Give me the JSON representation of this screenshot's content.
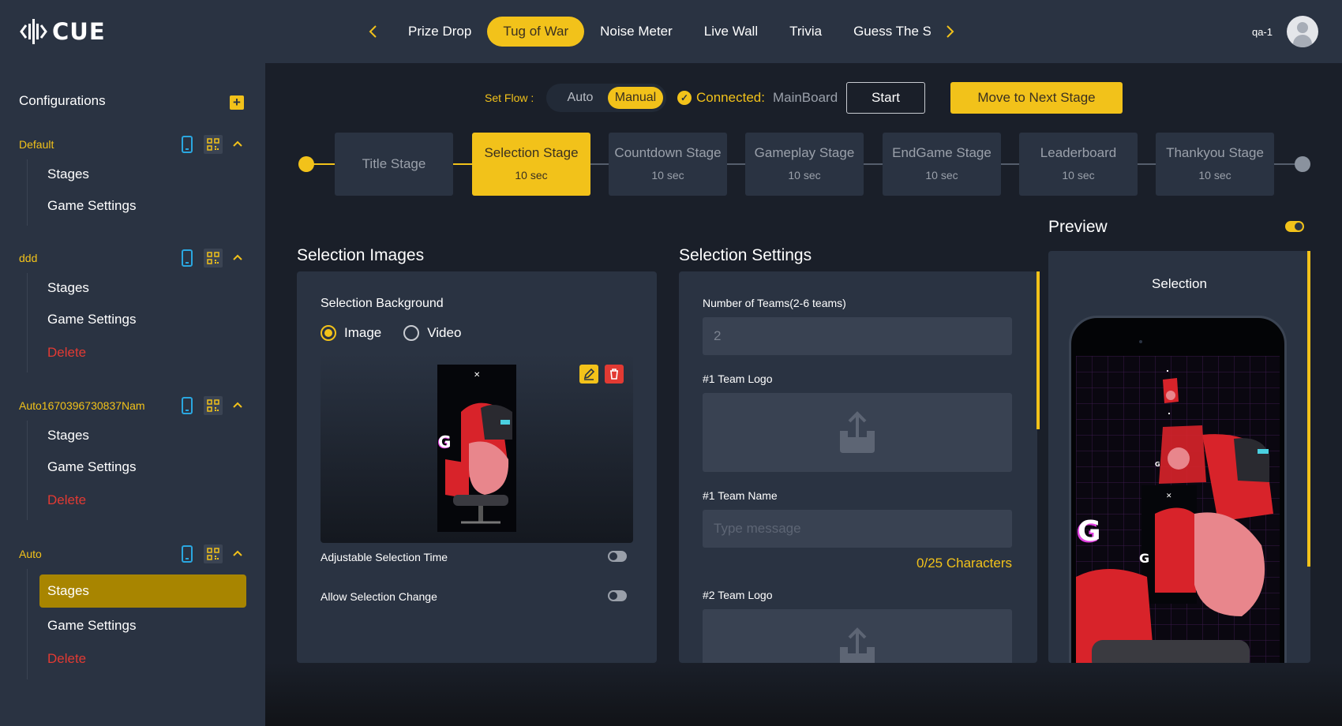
{
  "brand": {
    "name": "CUE"
  },
  "colors": {
    "accent": "#f2c21a",
    "danger": "#e23a33",
    "panel": "#2a3342",
    "background": "#1a1f29"
  },
  "nav": {
    "tabs": [
      {
        "label": "Prize Drop",
        "active": false
      },
      {
        "label": "Tug of War",
        "active": true
      },
      {
        "label": "Noise Meter",
        "active": false
      },
      {
        "label": "Live Wall",
        "active": false
      },
      {
        "label": "Trivia",
        "active": false
      },
      {
        "label": "Guess The Sc",
        "active": false
      }
    ],
    "prev_icon": "chevron-left-icon",
    "next_icon": "chevron-right-icon"
  },
  "user": {
    "name": "qa-1",
    "avatar_icon": "user-avatar-icon"
  },
  "sidebar": {
    "title": "Configurations",
    "add_icon": "plus-icon",
    "configs": [
      {
        "name": "Default",
        "items": [
          "Stages",
          "Game Settings"
        ],
        "active_item": null
      },
      {
        "name": "ddd",
        "items": [
          "Stages",
          "Game Settings",
          "Delete"
        ],
        "active_item": null
      },
      {
        "name": "Auto1670396730837Nam",
        "items": [
          "Stages",
          "Game Settings",
          "Delete"
        ],
        "active_item": null
      },
      {
        "name": "Auto",
        "items": [
          "Stages",
          "Game Settings",
          "Delete"
        ],
        "active_item": "Stages"
      }
    ]
  },
  "flow": {
    "label": "Set Flow :",
    "options": [
      "Auto",
      "Manual"
    ],
    "selected": "Manual",
    "connected_label": "Connected:",
    "connected_board": "MainBoard",
    "start_label": "Start",
    "next_stage_label": "Move to Next Stage"
  },
  "stages": [
    {
      "name": "Title Stage",
      "time": "",
      "active": false
    },
    {
      "name": "Selection Stage",
      "time": "10 sec",
      "active": true
    },
    {
      "name": "Countdown Stage",
      "time": "10 sec",
      "active": false
    },
    {
      "name": "Gameplay Stage",
      "time": "10 sec",
      "active": false
    },
    {
      "name": "EndGame Stage",
      "time": "10 sec",
      "active": false
    },
    {
      "name": "Leaderboard",
      "time": "10 sec",
      "active": false
    },
    {
      "name": "Thankyou Stage",
      "time": "10 sec",
      "active": false
    }
  ],
  "selection_images": {
    "title": "Selection Images",
    "background_label": "Selection Background",
    "media_options": [
      "Image",
      "Video"
    ],
    "media_selected": "Image",
    "adjustable_time_label": "Adjustable Selection Time",
    "adjustable_time_on": false,
    "allow_change_label": "Allow Selection Change",
    "allow_change_on": false
  },
  "selection_settings": {
    "title": "Selection Settings",
    "teams_label": "Number of Teams(2-6 teams)",
    "teams_value": "2",
    "team1_logo_label": "#1 Team Logo",
    "team1_name_label": "#1 Team Name",
    "team1_name_placeholder": "Type message",
    "char_count": "0/25 Characters",
    "team2_logo_label": "#2 Team Logo"
  },
  "preview": {
    "title": "Preview",
    "enabled": true,
    "screen_label": "Selection"
  }
}
